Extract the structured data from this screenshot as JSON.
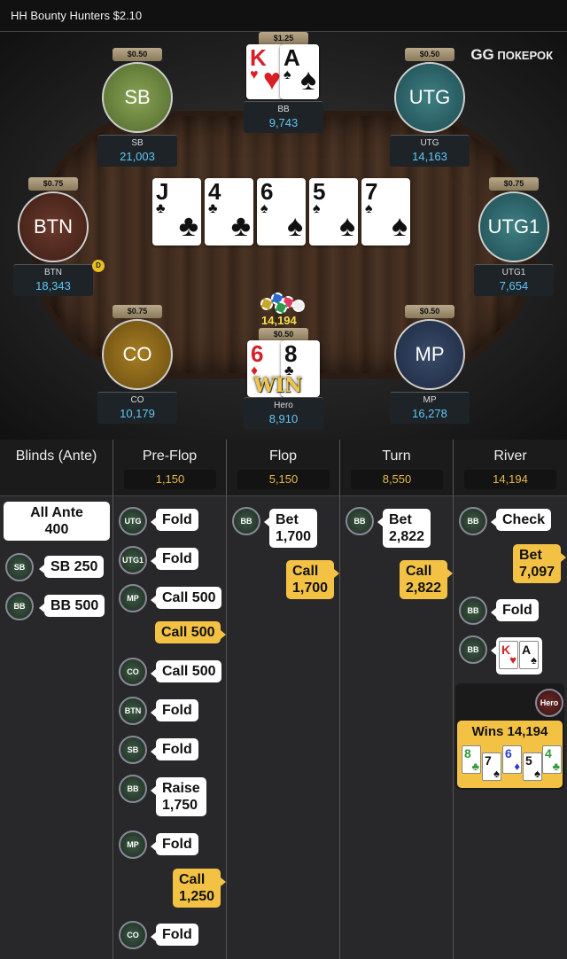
{
  "header": {
    "title": "HH  Bounty Hunters $2.10",
    "brand_prefix": "GG",
    "brand_name": "ПОКЕРОК"
  },
  "seats": {
    "bb": {
      "bet": "$1.25",
      "name": "BB",
      "stack": "9,743"
    },
    "sb": {
      "bet": "$0.50",
      "avatar": "SB",
      "name": "SB",
      "stack": "21,003"
    },
    "utg": {
      "bet": "$0.50",
      "avatar": "UTG",
      "name": "UTG",
      "stack": "14,163"
    },
    "btn": {
      "bet": "$0.75",
      "avatar": "BTN",
      "name": "BTN",
      "stack": "18,343"
    },
    "utg1": {
      "bet": "$0.75",
      "avatar": "UTG1",
      "name": "UTG1",
      "stack": "7,654"
    },
    "co": {
      "bet": "$0.75",
      "avatar": "CO",
      "name": "CO",
      "stack": "10,179"
    },
    "mp": {
      "bet": "$0.50",
      "avatar": "MP",
      "name": "MP",
      "stack": "16,278"
    },
    "hero": {
      "bet": "$0.50",
      "name": "Hero",
      "stack": "8,910"
    }
  },
  "dealer_label": "D",
  "pot": "14,194",
  "win_label": "WIN",
  "bb_cards": [
    {
      "rank": "K",
      "suit": "♥"
    },
    {
      "rank": "A",
      "suit": "♠"
    }
  ],
  "hero_cards": [
    {
      "rank": "6",
      "suit": "♦"
    },
    {
      "rank": "8",
      "suit": "♣"
    }
  ],
  "board": [
    {
      "rank": "J",
      "suit": "♣"
    },
    {
      "rank": "4",
      "suit": "♣"
    },
    {
      "rank": "6",
      "suit": "♠"
    },
    {
      "rank": "5",
      "suit": "♠"
    },
    {
      "rank": "7",
      "suit": "♠"
    }
  ],
  "columns": {
    "blinds": {
      "title": "Blinds (Ante)"
    },
    "preflop": {
      "title": "Pre-Flop",
      "pot": "1,150"
    },
    "flop": {
      "title": "Flop",
      "pot": "5,150"
    },
    "turn": {
      "title": "Turn",
      "pot": "8,550"
    },
    "river": {
      "title": "River",
      "pot": "14,194"
    }
  },
  "blinds": {
    "ante_line1": "All Ante",
    "ante_line2": "400",
    "sb_chip": "SB",
    "sb_text": "SB 250",
    "bb_chip": "BB",
    "bb_text": "BB 500"
  },
  "preflop": {
    "a1": {
      "chip": "UTG",
      "text": "Fold"
    },
    "a2": {
      "chip": "UTG1",
      "text": "Fold"
    },
    "a3": {
      "chip": "MP",
      "text": "Call 500"
    },
    "a4": {
      "text": "Call 500"
    },
    "a5": {
      "chip": "CO",
      "text": "Call 500"
    },
    "a6": {
      "chip": "BTN",
      "text": "Fold"
    },
    "a7": {
      "chip": "SB",
      "text": "Fold"
    },
    "a8": {
      "chip": "BB",
      "text1": "Raise",
      "text2": "1,750"
    },
    "a9": {
      "chip": "MP",
      "text": "Fold"
    },
    "a10": {
      "text1": "Call",
      "text2": "1,250"
    },
    "a11": {
      "chip": "CO",
      "text": "Fold"
    }
  },
  "flop": {
    "a1": {
      "chip": "BB",
      "text1": "Bet",
      "text2": "1,700"
    },
    "a2": {
      "text1": "Call",
      "text2": "1,700"
    }
  },
  "turn": {
    "a1": {
      "chip": "BB",
      "text1": "Bet",
      "text2": "2,822"
    },
    "a2": {
      "text1": "Call",
      "text2": "2,822"
    }
  },
  "river": {
    "a1": {
      "chip": "BB",
      "text": "Check"
    },
    "a2": {
      "text1": "Bet",
      "text2": "7,097"
    },
    "a3": {
      "chip": "BB",
      "text": "Fold"
    },
    "a4": {
      "chip": "BB"
    },
    "shown_cards": [
      {
        "rank": "K",
        "suit": "♥"
      },
      {
        "rank": "A",
        "suit": "♠"
      }
    ],
    "hero_chip": "Hero",
    "wins_text": "Wins 14,194",
    "hand": [
      {
        "rank": "8",
        "suit": "♣"
      },
      {
        "rank": "7",
        "suit": "♠"
      },
      {
        "rank": "6",
        "suit": "♦"
      },
      {
        "rank": "5",
        "suit": "♠"
      },
      {
        "rank": "4",
        "suit": "♣"
      }
    ]
  },
  "colors": {
    "accent_gold": "#f3c245",
    "stack_blue": "#5ec8f5",
    "pot_yellow": "#f4e14a"
  }
}
